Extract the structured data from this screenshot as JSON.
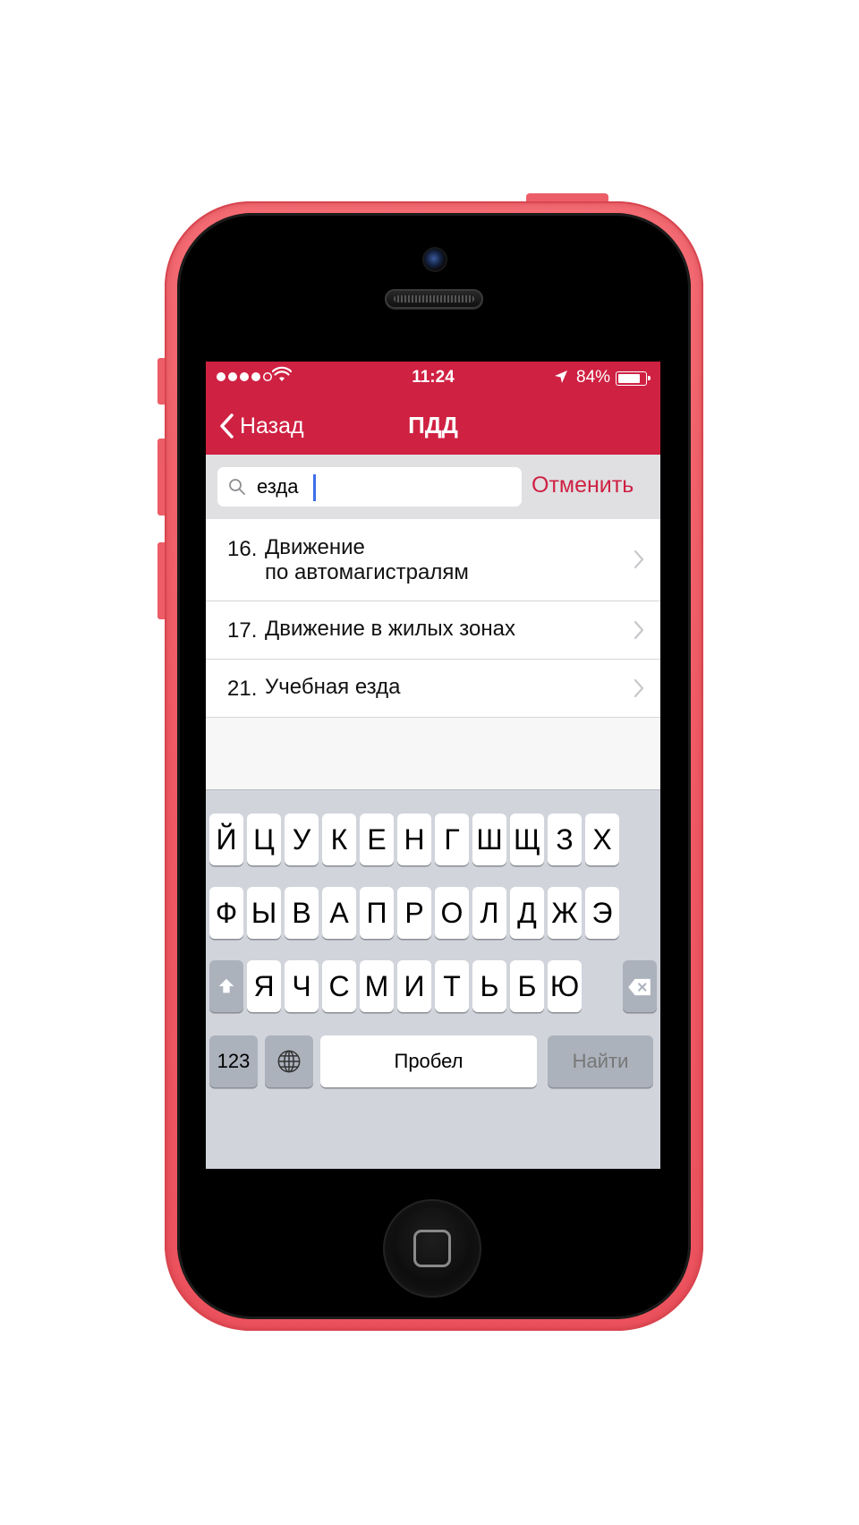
{
  "status_bar": {
    "signal_dots_filled": 4,
    "signal_dots_total": 5,
    "time": "11:24",
    "battery_percent_label": "84%",
    "battery_level": 0.84
  },
  "nav": {
    "back_label": "Назад",
    "title": "ПДД",
    "bar_color": "#cf2142"
  },
  "search": {
    "value": "езда",
    "cancel_label": "Отменить"
  },
  "results": [
    {
      "number": "16.",
      "text_line1": "Движение",
      "text_line2": "по автомагистралям"
    },
    {
      "number": "17.",
      "text_line1": "Движение в жилых зонах",
      "text_line2": ""
    },
    {
      "number": "21.",
      "text_line1": "Учебная езда",
      "text_line2": ""
    }
  ],
  "keyboard": {
    "row1": [
      "Й",
      "Ц",
      "У",
      "К",
      "Е",
      "Н",
      "Г",
      "Ш",
      "Щ",
      "З",
      "Х"
    ],
    "row2": [
      "Ф",
      "Ы",
      "В",
      "А",
      "П",
      "Р",
      "О",
      "Л",
      "Д",
      "Ж",
      "Э"
    ],
    "row3": [
      "Я",
      "Ч",
      "С",
      "М",
      "И",
      "Т",
      "Ь",
      "Б",
      "Ю"
    ],
    "numbers_label": "123",
    "space_label": "Пробел",
    "search_label": "Найти"
  }
}
